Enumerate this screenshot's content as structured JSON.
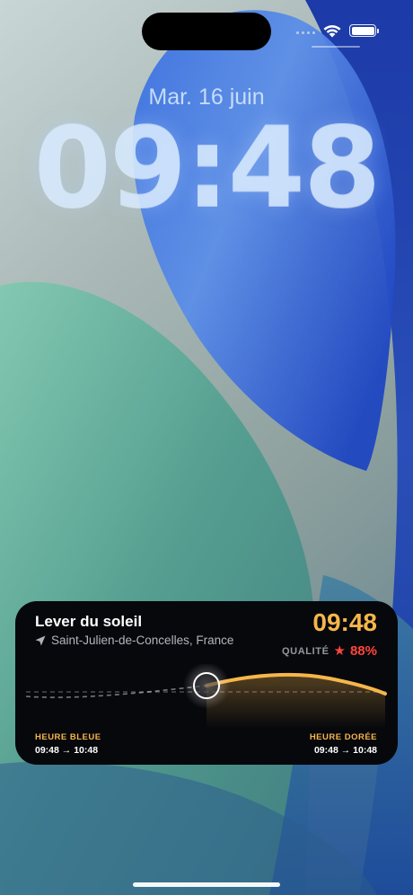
{
  "status_bar": {
    "wifi_icon": "wifi-icon",
    "battery_icon": "battery-icon"
  },
  "lock_screen": {
    "date": "Mar. 16 juin",
    "time": "09:48"
  },
  "widget": {
    "title": "Lever du soleil",
    "location_icon": "location-arrow-icon",
    "location": "Saint-Julien-de-Concelles, France",
    "time": "09:48",
    "quality_label": "QUALITÉ",
    "quality_icon": "star-icon",
    "quality_star": "★",
    "quality_value": "88%",
    "blue_hour_label": "HEURE BLEUE",
    "blue_hour_range": "09:48 → 10:48",
    "golden_hour_label": "HEURE DORÉE",
    "golden_hour_range": "09:48 → 10:48",
    "colors": {
      "accent": "#f6b64a",
      "quality": "#ff453a",
      "background": "#07080c"
    }
  }
}
